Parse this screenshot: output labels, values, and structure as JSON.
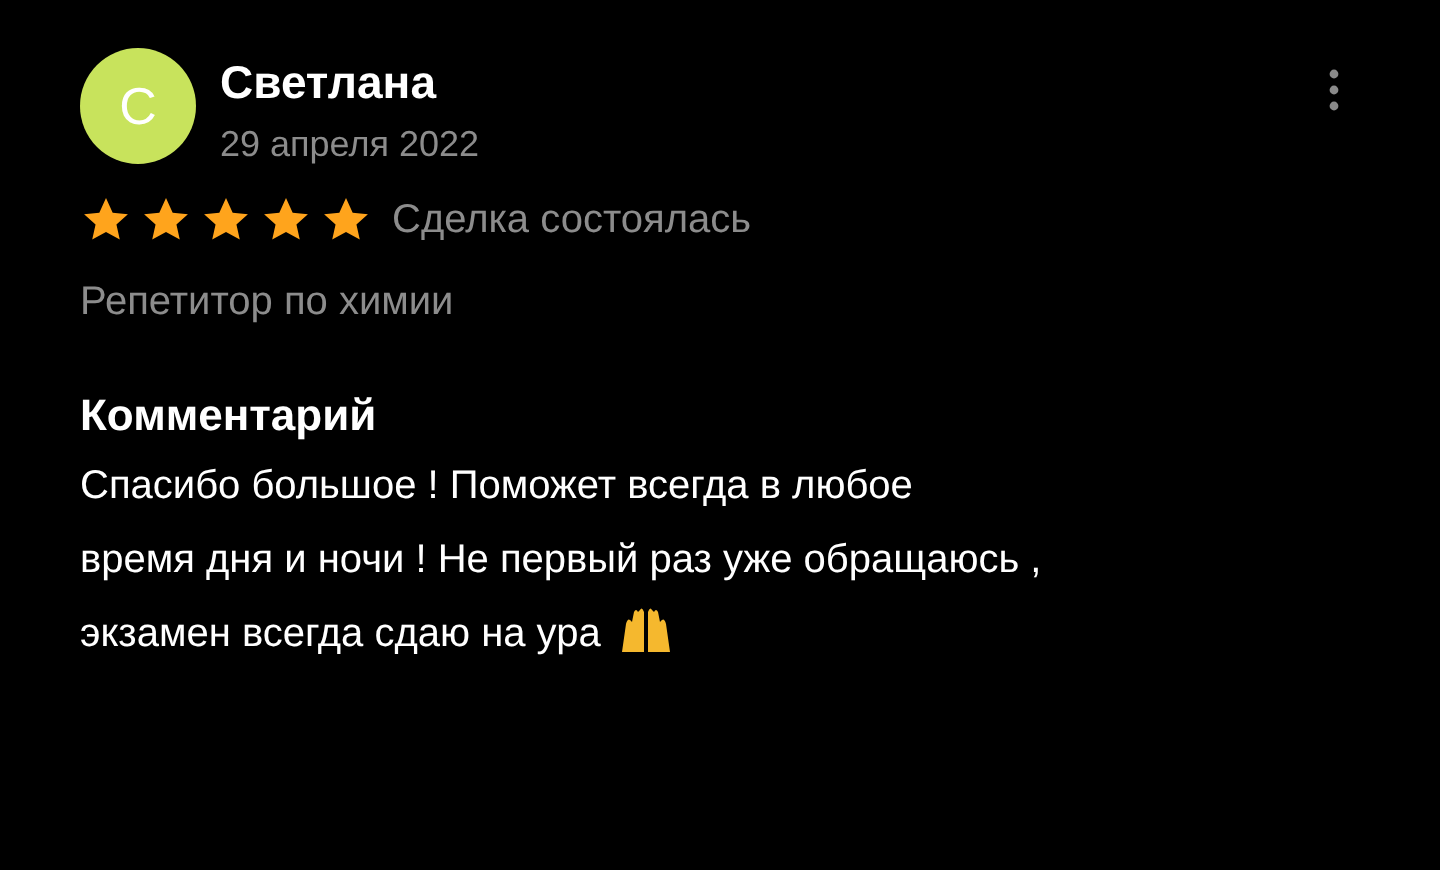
{
  "review": {
    "avatar_letter": "С",
    "author": "Светлана",
    "date": "29 апреля 2022",
    "stars": 5,
    "deal_status": "Сделка состоялась",
    "service": "Репетитор по химии"
  },
  "comment": {
    "heading": "Комментарий",
    "lines": [
      "Спасибо большое ! Поможет всегда в любое",
      "время дня и ночи ! Не первый раз уже обращаюсь ,",
      "экзамен всегда сдаю на ура"
    ]
  }
}
